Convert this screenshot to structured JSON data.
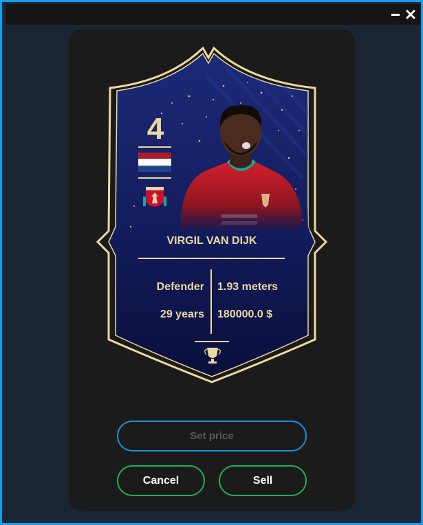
{
  "window": {
    "minimize_icon": "minimize-icon",
    "close_icon": "close-icon"
  },
  "card": {
    "rating": "4",
    "nation_flag": "netherlands-flag",
    "club_badge": "liverpool-badge",
    "player_image": "player-photo",
    "name": "VIRGIL VAN DIJK",
    "position": "Defender",
    "height": "1.93 meters",
    "age": "29 years",
    "value": "180000.0 $",
    "footer_icon": "trophy-icon",
    "colors": {
      "gold": "#ecd9a0",
      "card_top": "#1c2a78",
      "card_bottom": "#0a0f3c",
      "shirt": "#d0202b"
    }
  },
  "form": {
    "price_placeholder": "Set price",
    "price_value": "",
    "cancel_label": "Cancel",
    "sell_label": "Sell",
    "colors": {
      "input_border": "#1f8fe0",
      "button_border": "#1fae5a"
    }
  }
}
